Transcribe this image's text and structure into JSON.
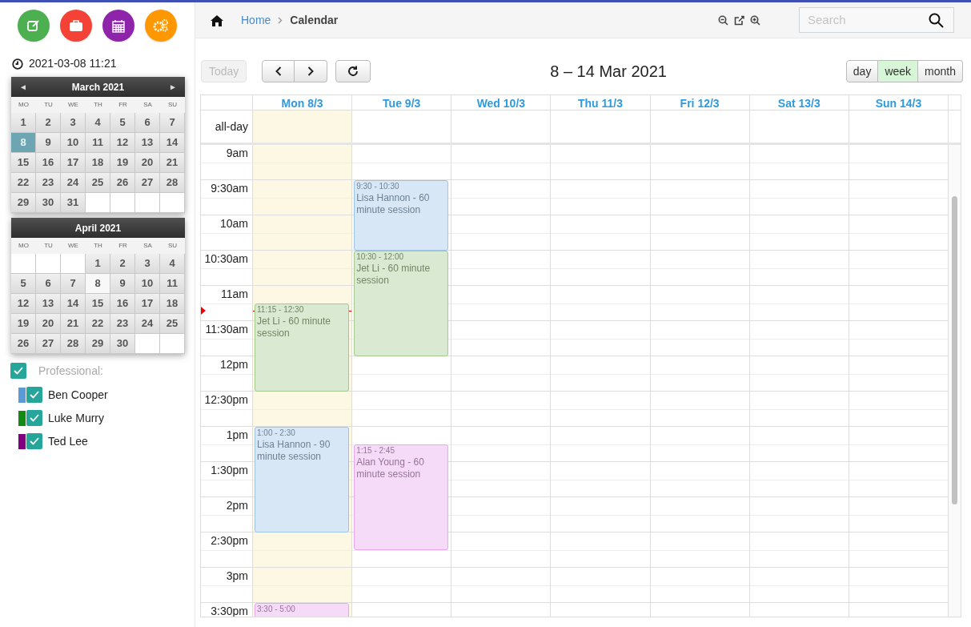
{
  "clock": "2021-03-08 11:21",
  "mini_calendars": [
    {
      "title": "March 2021",
      "nav": {
        "prev": "◄",
        "next": "►"
      },
      "weekdays": [
        "MO",
        "TU",
        "WE",
        "TH",
        "FR",
        "SA",
        "SU"
      ],
      "cells": [
        {
          "kind": "day",
          "d": "1",
          "selected": false
        },
        {
          "kind": "day",
          "d": "2",
          "selected": false
        },
        {
          "kind": "day",
          "d": "3",
          "selected": false
        },
        {
          "kind": "day",
          "d": "4",
          "selected": false
        },
        {
          "kind": "day",
          "d": "5",
          "selected": false
        },
        {
          "kind": "day",
          "d": "6",
          "selected": false
        },
        {
          "kind": "day",
          "d": "7",
          "selected": false
        },
        {
          "kind": "day",
          "d": "8",
          "selected": true
        },
        {
          "kind": "day",
          "d": "9",
          "selected": false
        },
        {
          "kind": "day",
          "d": "10",
          "selected": false
        },
        {
          "kind": "day",
          "d": "11",
          "selected": false
        },
        {
          "kind": "day",
          "d": "12",
          "selected": false
        },
        {
          "kind": "day",
          "d": "13",
          "selected": false
        },
        {
          "kind": "day",
          "d": "14",
          "selected": false
        },
        {
          "kind": "day",
          "d": "15",
          "selected": false
        },
        {
          "kind": "day",
          "d": "16",
          "selected": false
        },
        {
          "kind": "day",
          "d": "17",
          "selected": false
        },
        {
          "kind": "day",
          "d": "18",
          "selected": false
        },
        {
          "kind": "day",
          "d": "19",
          "selected": false
        },
        {
          "kind": "day",
          "d": "20",
          "selected": false
        },
        {
          "kind": "day",
          "d": "21",
          "selected": false
        },
        {
          "kind": "day",
          "d": "22",
          "selected": false
        },
        {
          "kind": "day",
          "d": "23",
          "selected": false
        },
        {
          "kind": "day",
          "d": "24",
          "selected": false
        },
        {
          "kind": "day",
          "d": "25",
          "selected": false
        },
        {
          "kind": "day",
          "d": "26",
          "selected": false
        },
        {
          "kind": "day",
          "d": "27",
          "selected": false
        },
        {
          "kind": "day",
          "d": "28",
          "selected": false
        },
        {
          "kind": "day",
          "d": "29",
          "selected": false
        },
        {
          "kind": "day",
          "d": "30",
          "selected": false
        },
        {
          "kind": "day",
          "d": "31",
          "selected": false
        },
        {
          "kind": "blank"
        },
        {
          "kind": "blank"
        },
        {
          "kind": "blank"
        },
        {
          "kind": "blank"
        }
      ]
    },
    {
      "title": "April 2021",
      "weekdays": [
        "MO",
        "TU",
        "WE",
        "TH",
        "FR",
        "SA",
        "SU"
      ],
      "cells": [
        {
          "kind": "blank"
        },
        {
          "kind": "blank"
        },
        {
          "kind": "blank"
        },
        {
          "kind": "day",
          "d": "1",
          "selected": false
        },
        {
          "kind": "day",
          "d": "2",
          "selected": false
        },
        {
          "kind": "day",
          "d": "3",
          "selected": false
        },
        {
          "kind": "day",
          "d": "4",
          "selected": false
        },
        {
          "kind": "day",
          "d": "5",
          "selected": false
        },
        {
          "kind": "day",
          "d": "6",
          "selected": false
        },
        {
          "kind": "day",
          "d": "7",
          "selected": false
        },
        {
          "kind": "marked",
          "d": "8",
          "selected": false
        },
        {
          "kind": "day",
          "d": "9",
          "selected": false
        },
        {
          "kind": "day",
          "d": "10",
          "selected": false
        },
        {
          "kind": "day",
          "d": "11",
          "selected": false
        },
        {
          "kind": "day",
          "d": "12",
          "selected": false
        },
        {
          "kind": "day",
          "d": "13",
          "selected": false
        },
        {
          "kind": "day",
          "d": "14",
          "selected": false
        },
        {
          "kind": "day",
          "d": "15",
          "selected": false
        },
        {
          "kind": "day",
          "d": "16",
          "selected": false
        },
        {
          "kind": "day",
          "d": "17",
          "selected": false
        },
        {
          "kind": "day",
          "d": "18",
          "selected": false
        },
        {
          "kind": "day",
          "d": "19",
          "selected": false
        },
        {
          "kind": "day",
          "d": "20",
          "selected": false
        },
        {
          "kind": "day",
          "d": "21",
          "selected": false
        },
        {
          "kind": "day",
          "d": "22",
          "selected": false
        },
        {
          "kind": "day",
          "d": "23",
          "selected": false
        },
        {
          "kind": "day",
          "d": "24",
          "selected": false
        },
        {
          "kind": "day",
          "d": "25",
          "selected": false
        },
        {
          "kind": "day",
          "d": "26",
          "selected": false
        },
        {
          "kind": "day",
          "d": "27",
          "selected": false
        },
        {
          "kind": "day",
          "d": "28",
          "selected": false
        },
        {
          "kind": "day",
          "d": "29",
          "selected": false
        },
        {
          "kind": "day",
          "d": "30",
          "selected": false
        },
        {
          "kind": "blank"
        },
        {
          "kind": "blank"
        }
      ]
    }
  ],
  "professionals": {
    "label": "Professional:",
    "checked": true,
    "items": [
      {
        "name": "Ben Cooper",
        "checked": true,
        "color": "#5b9bd5"
      },
      {
        "name": "Luke Murry",
        "checked": true,
        "color": "#138a13"
      },
      {
        "name": "Ted Lee",
        "checked": true,
        "color": "#800080"
      }
    ]
  },
  "breadcrumb": [
    "Home",
    "Calendar"
  ],
  "search": {
    "placeholder": "Search"
  },
  "toolbar": {
    "today": {
      "label": "Today",
      "disabled": true
    },
    "title": "8 – 14 Mar 2021",
    "views": [
      {
        "label": "day",
        "selected": false
      },
      {
        "label": "week",
        "selected": true
      },
      {
        "label": "month",
        "selected": false
      }
    ]
  },
  "calendar": {
    "all_day_label": "all-day",
    "days": [
      {
        "label": "Mon 8/3",
        "today": true,
        "events": [
          {
            "time": "11:15 - 12:30",
            "title": "Jet Li - 60 minute session",
            "color": "#a3c98c"
          },
          {
            "time": "1:00 - 2:30",
            "title": "Lisa Hannon - 90 minute session",
            "color": "#9ec3e6"
          },
          {
            "time": "3:30 - 5:00",
            "color": "#e9a6ef"
          }
        ]
      },
      {
        "label": "Tue 9/3",
        "today": false,
        "events": [
          {
            "time": "9:30 - 10:30",
            "title": "Lisa Hannon - 60 minute session",
            "color": "#9ec3e6"
          },
          {
            "time": "10:30 - 12:00",
            "title": "Jet Li - 60 minute session",
            "color": "#a3c98c"
          },
          {
            "time": "1:15 - 2:45",
            "title": "Alan Young - 60 minute session",
            "color": "#e9a6ef"
          }
        ]
      },
      {
        "label": "Wed 10/3",
        "today": false
      },
      {
        "label": "Thu 11/3",
        "today": false
      },
      {
        "label": "Fri 12/3",
        "today": false
      },
      {
        "label": "Sat 13/3",
        "today": false
      },
      {
        "label": "Sun 14/3",
        "today": false
      }
    ],
    "times": [
      "9am",
      "9:30am",
      "10am",
      "10:30am",
      "11am",
      "11:30am",
      "12pm",
      "12:30pm",
      "1pm",
      "1:30pm",
      "2pm",
      "2:30pm",
      "3pm",
      "3:30pm"
    ]
  }
}
